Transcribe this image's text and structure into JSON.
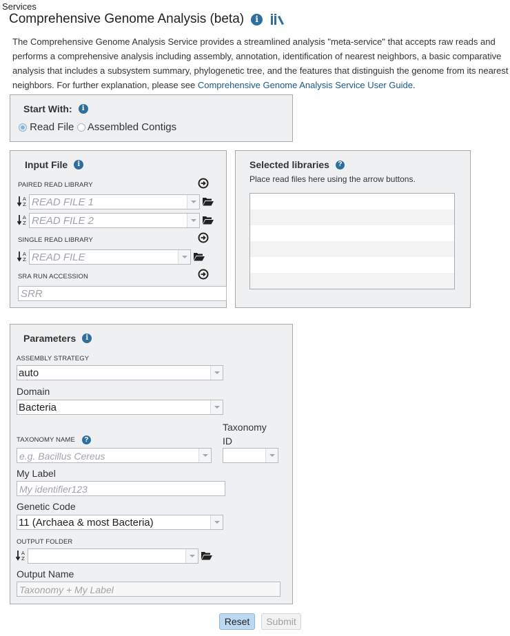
{
  "breadcrumb": "Services",
  "header": {
    "title": "Comprehensive Genome Analysis (beta)",
    "info_icon": "info-circle-icon",
    "library_icon": "books-icon"
  },
  "description": {
    "text": "The Comprehensive Genome Analysis Service provides a streamlined analysis \"meta-service\" that accepts raw reads and performs a comprehensive analysis including assembly, annotation, identification of nearest neighbors, a basic comparative analysis that includes a subsystem summary, phylogenetic tree, and the features that distinguish the genome from its nearest neighbors. For further explanation, please see ",
    "link_text": "Comprehensive Genome Analysis Service User Guide",
    "suffix": "."
  },
  "start_with": {
    "title": "Start With:",
    "options": [
      {
        "label": "Read File",
        "checked": true
      },
      {
        "label": "Assembled Contigs",
        "checked": false
      }
    ]
  },
  "input_file": {
    "title": "Input File",
    "paired_label": "PAIRED READ LIBRARY",
    "read_file_1_placeholder": "READ FILE 1",
    "read_file_2_placeholder": "READ FILE 2",
    "single_label": "SINGLE READ LIBRARY",
    "read_file_placeholder": "READ FILE",
    "sra_label": "SRA RUN ACCESSION",
    "sra_placeholder": "SRR"
  },
  "selected_libraries": {
    "title": "Selected libraries",
    "hint": "Place read files here using the arrow buttons.",
    "rows": [
      "",
      "",
      "",
      "",
      "",
      ""
    ]
  },
  "parameters": {
    "title": "Parameters",
    "assembly_strategy_label": "ASSEMBLY STRATEGY",
    "assembly_strategy_value": "auto",
    "domain_label": "Domain",
    "domain_value": "Bacteria",
    "taxonomy_name_label": "TAXONOMY NAME",
    "taxonomy_name_placeholder": "e.g. Bacillus Cereus",
    "taxonomy_id_label_1": "Taxonomy",
    "taxonomy_id_label_2": "ID",
    "taxonomy_id_value": "",
    "my_label_label": "My Label",
    "my_label_placeholder": "My identifier123",
    "genetic_code_label": "Genetic Code",
    "genetic_code_value": "11 (Archaea & most Bacteria)",
    "output_folder_label": "OUTPUT FOLDER",
    "output_folder_value": "",
    "output_name_label": "Output Name",
    "output_name_placeholder": "Taxonomy + My Label"
  },
  "buttons": {
    "reset": "Reset",
    "submit": "Submit"
  },
  "colors": {
    "accent_icon": "#2e6f9e",
    "panel_bg": "#eff0f2",
    "link": "#1a5a8a",
    "reset_bg": "#bcd8f2"
  }
}
